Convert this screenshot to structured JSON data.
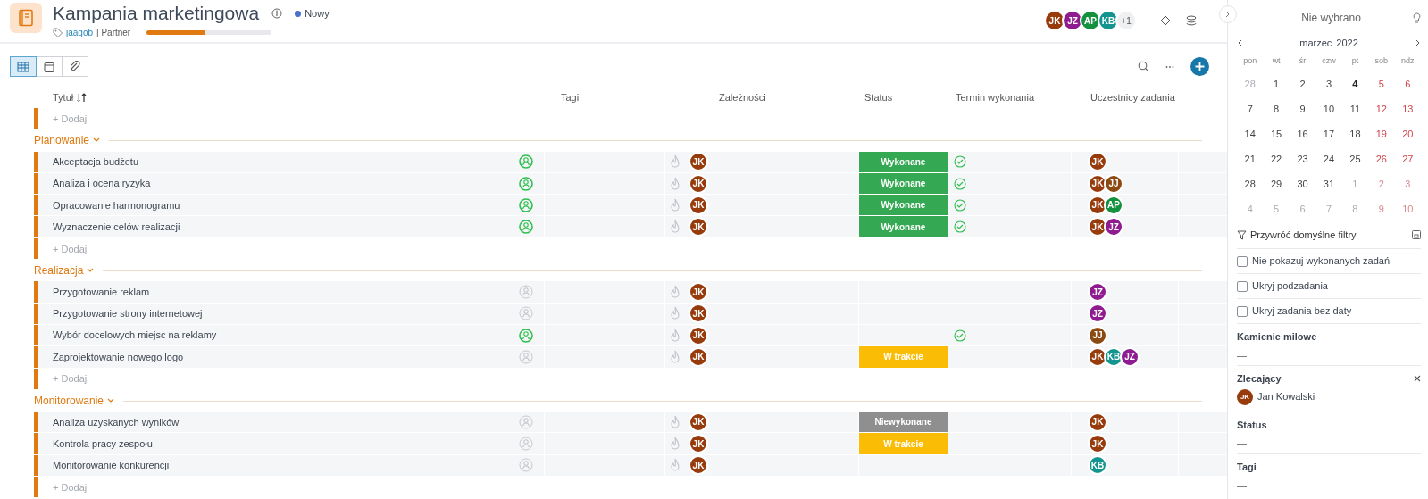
{
  "project": {
    "title": "Kampania marketingowa",
    "status": "Nowy",
    "tag": "jaaqob",
    "client": "| Partner",
    "progress": {
      "level": 0.46
    }
  },
  "members": [
    {
      "initials": "JK",
      "color": "#973b0c"
    },
    {
      "initials": "JZ",
      "color": "#8e1b8f"
    },
    {
      "initials": "AP",
      "color": "#14913f"
    },
    {
      "initials": "KB",
      "color": "#13948e"
    }
  ],
  "members_more": "+1",
  "views": [
    {
      "kind": "table",
      "selected": true
    },
    {
      "kind": "calendar",
      "selected": false
    },
    {
      "kind": "attachment",
      "selected": false
    }
  ],
  "columns": [
    "Tytuł",
    "Tagi",
    "Zależności",
    "Status",
    "Termin wykonania",
    "Uczestnicy zadania"
  ],
  "top_add": "+ Dodaj",
  "groups": [
    {
      "name": "Planowanie",
      "expanded": true,
      "add": "+ Dodaj",
      "tasks": [
        {
          "title": "Akceptacja budżetu",
          "assigned": true,
          "dependency": {
            "initials": "JK",
            "color": "#973b0c"
          },
          "status": {
            "kind": "done",
            "label": "Wykonane"
          },
          "deadline_done": true,
          "participants": [
            {
              "initials": "JK",
              "color": "#973b0c"
            }
          ]
        },
        {
          "title": "Analiza i ocena ryzyka",
          "assigned": true,
          "dependency": {
            "initials": "JK",
            "color": "#973b0c"
          },
          "status": {
            "kind": "done",
            "label": "Wykonane"
          },
          "deadline_done": true,
          "participants": [
            {
              "initials": "JK",
              "color": "#973b0c"
            },
            {
              "initials": "JJ",
              "color": "#8c4a12"
            }
          ]
        },
        {
          "title": "Opracowanie harmonogramu",
          "assigned": true,
          "dependency": {
            "initials": "JK",
            "color": "#973b0c"
          },
          "status": {
            "kind": "done",
            "label": "Wykonane"
          },
          "deadline_done": true,
          "participants": [
            {
              "initials": "JK",
              "color": "#973b0c"
            },
            {
              "initials": "AP",
              "color": "#14913f"
            }
          ]
        },
        {
          "title": "Wyznaczenie celów realizacji",
          "assigned": true,
          "dependency": {
            "initials": "JK",
            "color": "#973b0c"
          },
          "status": {
            "kind": "done",
            "label": "Wykonane"
          },
          "deadline_done": true,
          "participants": [
            {
              "initials": "JK",
              "color": "#973b0c"
            },
            {
              "initials": "JZ",
              "color": "#8e1b8f"
            }
          ]
        }
      ]
    },
    {
      "name": "Realizacja",
      "expanded": true,
      "add": "+ Dodaj",
      "tasks": [
        {
          "title": "Przygotowanie reklam",
          "assigned": false,
          "dependency": {
            "initials": "JK",
            "color": "#973b0c"
          },
          "status": {
            "kind": "none"
          },
          "deadline_done": false,
          "participants": [
            {
              "initials": "JZ",
              "color": "#8e1b8f"
            }
          ]
        },
        {
          "title": "Przygotowanie strony internetowej",
          "assigned": false,
          "dependency": {
            "initials": "JK",
            "color": "#973b0c"
          },
          "status": {
            "kind": "none"
          },
          "deadline_done": false,
          "participants": [
            {
              "initials": "JZ",
              "color": "#8e1b8f"
            }
          ]
        },
        {
          "title": "Wybór docelowych miejsc na reklamy",
          "assigned": true,
          "dependency": {
            "initials": "JK",
            "color": "#973b0c"
          },
          "status": {
            "kind": "none"
          },
          "deadline_done": true,
          "participants": [
            {
              "initials": "JJ",
              "color": "#8c4a12"
            }
          ]
        },
        {
          "title": "Zaprojektowanie nowego logo",
          "assigned": false,
          "dependency": {
            "initials": "JK",
            "color": "#973b0c"
          },
          "status": {
            "kind": "in_progress",
            "label": "W trakcie"
          },
          "deadline_done": false,
          "participants": [
            {
              "initials": "JK",
              "color": "#973b0c"
            },
            {
              "initials": "KB",
              "color": "#13948e"
            },
            {
              "initials": "JZ",
              "color": "#8e1b8f"
            }
          ]
        }
      ]
    },
    {
      "name": "Monitorowanie",
      "expanded": true,
      "add": "+ Dodaj",
      "tasks": [
        {
          "title": "Analiza uzyskanych wyników",
          "assigned": false,
          "dependency": {
            "initials": "JK",
            "color": "#973b0c"
          },
          "status": {
            "kind": "not_done",
            "label": "Niewykonane"
          },
          "deadline_done": false,
          "participants": [
            {
              "initials": "JK",
              "color": "#973b0c"
            }
          ]
        },
        {
          "title": "Kontrola pracy zespołu",
          "assigned": false,
          "dependency": {
            "initials": "JK",
            "color": "#973b0c"
          },
          "status": {
            "kind": "in_progress",
            "label": "W trakcie"
          },
          "deadline_done": false,
          "participants": [
            {
              "initials": "JK",
              "color": "#973b0c"
            }
          ]
        },
        {
          "title": "Monitorowanie konkurencji",
          "assigned": false,
          "dependency": {
            "initials": "JK",
            "color": "#973b0c"
          },
          "status": {
            "kind": "none"
          },
          "deadline_done": false,
          "participants": [
            {
              "initials": "KB",
              "color": "#13948e"
            }
          ]
        }
      ]
    }
  ],
  "panel": {
    "title": "Nie wybrano",
    "month": "marzec",
    "year": "2022",
    "weekdays": [
      "pon",
      "wt",
      "śr",
      "czw",
      "pt",
      "sob",
      "ndz"
    ],
    "days": [
      {
        "day": "28",
        "other_month": true,
        "weekend": false,
        "today": false
      },
      {
        "day": "1",
        "other_month": false,
        "weekend": false,
        "today": false
      },
      {
        "day": "2",
        "other_month": false,
        "weekend": false,
        "today": false
      },
      {
        "day": "3",
        "other_month": false,
        "weekend": false,
        "today": false
      },
      {
        "day": "4",
        "other_month": false,
        "weekend": false,
        "today": true
      },
      {
        "day": "5",
        "other_month": false,
        "weekend": true,
        "today": false
      },
      {
        "day": "6",
        "other_month": false,
        "weekend": true,
        "today": false
      },
      {
        "day": "7",
        "other_month": false,
        "weekend": false,
        "today": false
      },
      {
        "day": "8",
        "other_month": false,
        "weekend": false,
        "today": false
      },
      {
        "day": "9",
        "other_month": false,
        "weekend": false,
        "today": false
      },
      {
        "day": "10",
        "other_month": false,
        "weekend": false,
        "today": false
      },
      {
        "day": "11",
        "other_month": false,
        "weekend": false,
        "today": false
      },
      {
        "day": "12",
        "other_month": false,
        "weekend": true,
        "today": false
      },
      {
        "day": "13",
        "other_month": false,
        "weekend": true,
        "today": false
      },
      {
        "day": "14",
        "other_month": false,
        "weekend": false,
        "today": false
      },
      {
        "day": "15",
        "other_month": false,
        "weekend": false,
        "today": false
      },
      {
        "day": "16",
        "other_month": false,
        "weekend": false,
        "today": false
      },
      {
        "day": "17",
        "other_month": false,
        "weekend": false,
        "today": false
      },
      {
        "day": "18",
        "other_month": false,
        "weekend": false,
        "today": false
      },
      {
        "day": "19",
        "other_month": false,
        "weekend": true,
        "today": false
      },
      {
        "day": "20",
        "other_month": false,
        "weekend": true,
        "today": false
      },
      {
        "day": "21",
        "other_month": false,
        "weekend": false,
        "today": false
      },
      {
        "day": "22",
        "other_month": false,
        "weekend": false,
        "today": false
      },
      {
        "day": "23",
        "other_month": false,
        "weekend": false,
        "today": false
      },
      {
        "day": "24",
        "other_month": false,
        "weekend": false,
        "today": false
      },
      {
        "day": "25",
        "other_month": false,
        "weekend": false,
        "today": false
      },
      {
        "day": "26",
        "other_month": false,
        "weekend": true,
        "today": false
      },
      {
        "day": "27",
        "other_month": false,
        "weekend": true,
        "today": false
      },
      {
        "day": "28",
        "other_month": false,
        "weekend": false,
        "today": false
      },
      {
        "day": "29",
        "other_month": false,
        "weekend": false,
        "today": false
      },
      {
        "day": "30",
        "other_month": false,
        "weekend": false,
        "today": false
      },
      {
        "day": "31",
        "other_month": false,
        "weekend": false,
        "today": false
      },
      {
        "day": "1",
        "other_month": true,
        "weekend": false,
        "today": false
      },
      {
        "day": "2",
        "other_month": true,
        "weekend": true,
        "today": false
      },
      {
        "day": "3",
        "other_month": true,
        "weekend": true,
        "today": false
      },
      {
        "day": "4",
        "other_month": true,
        "weekend": false,
        "today": false
      },
      {
        "day": "5",
        "other_month": true,
        "weekend": false,
        "today": false
      },
      {
        "day": "6",
        "other_month": true,
        "weekend": false,
        "today": false
      },
      {
        "day": "7",
        "other_month": true,
        "weekend": false,
        "today": false
      },
      {
        "day": "8",
        "other_month": true,
        "weekend": false,
        "today": false
      },
      {
        "day": "9",
        "other_month": true,
        "weekend": true,
        "today": false
      },
      {
        "day": "10",
        "other_month": true,
        "weekend": true,
        "today": false
      }
    ],
    "reset_filters": "Przywróć domyślne filtry",
    "filters": [
      {
        "label": "Nie pokazuj wykonanych zadań",
        "checked": false
      },
      {
        "label": "Ukryj podzadania",
        "checked": false
      },
      {
        "label": "Ukryj zadania bez daty",
        "checked": false
      }
    ],
    "sections": [
      {
        "kind": "value",
        "title": "Kamienie milowe",
        "value": "—"
      },
      {
        "kind": "person",
        "title": "Zlecający",
        "person": {
          "initials": "JK",
          "color": "#973b0c",
          "name": "Jan Kowalski"
        }
      },
      {
        "kind": "value",
        "title": "Status",
        "value": "—"
      },
      {
        "kind": "value",
        "title": "Tagi",
        "value": "—"
      }
    ]
  }
}
